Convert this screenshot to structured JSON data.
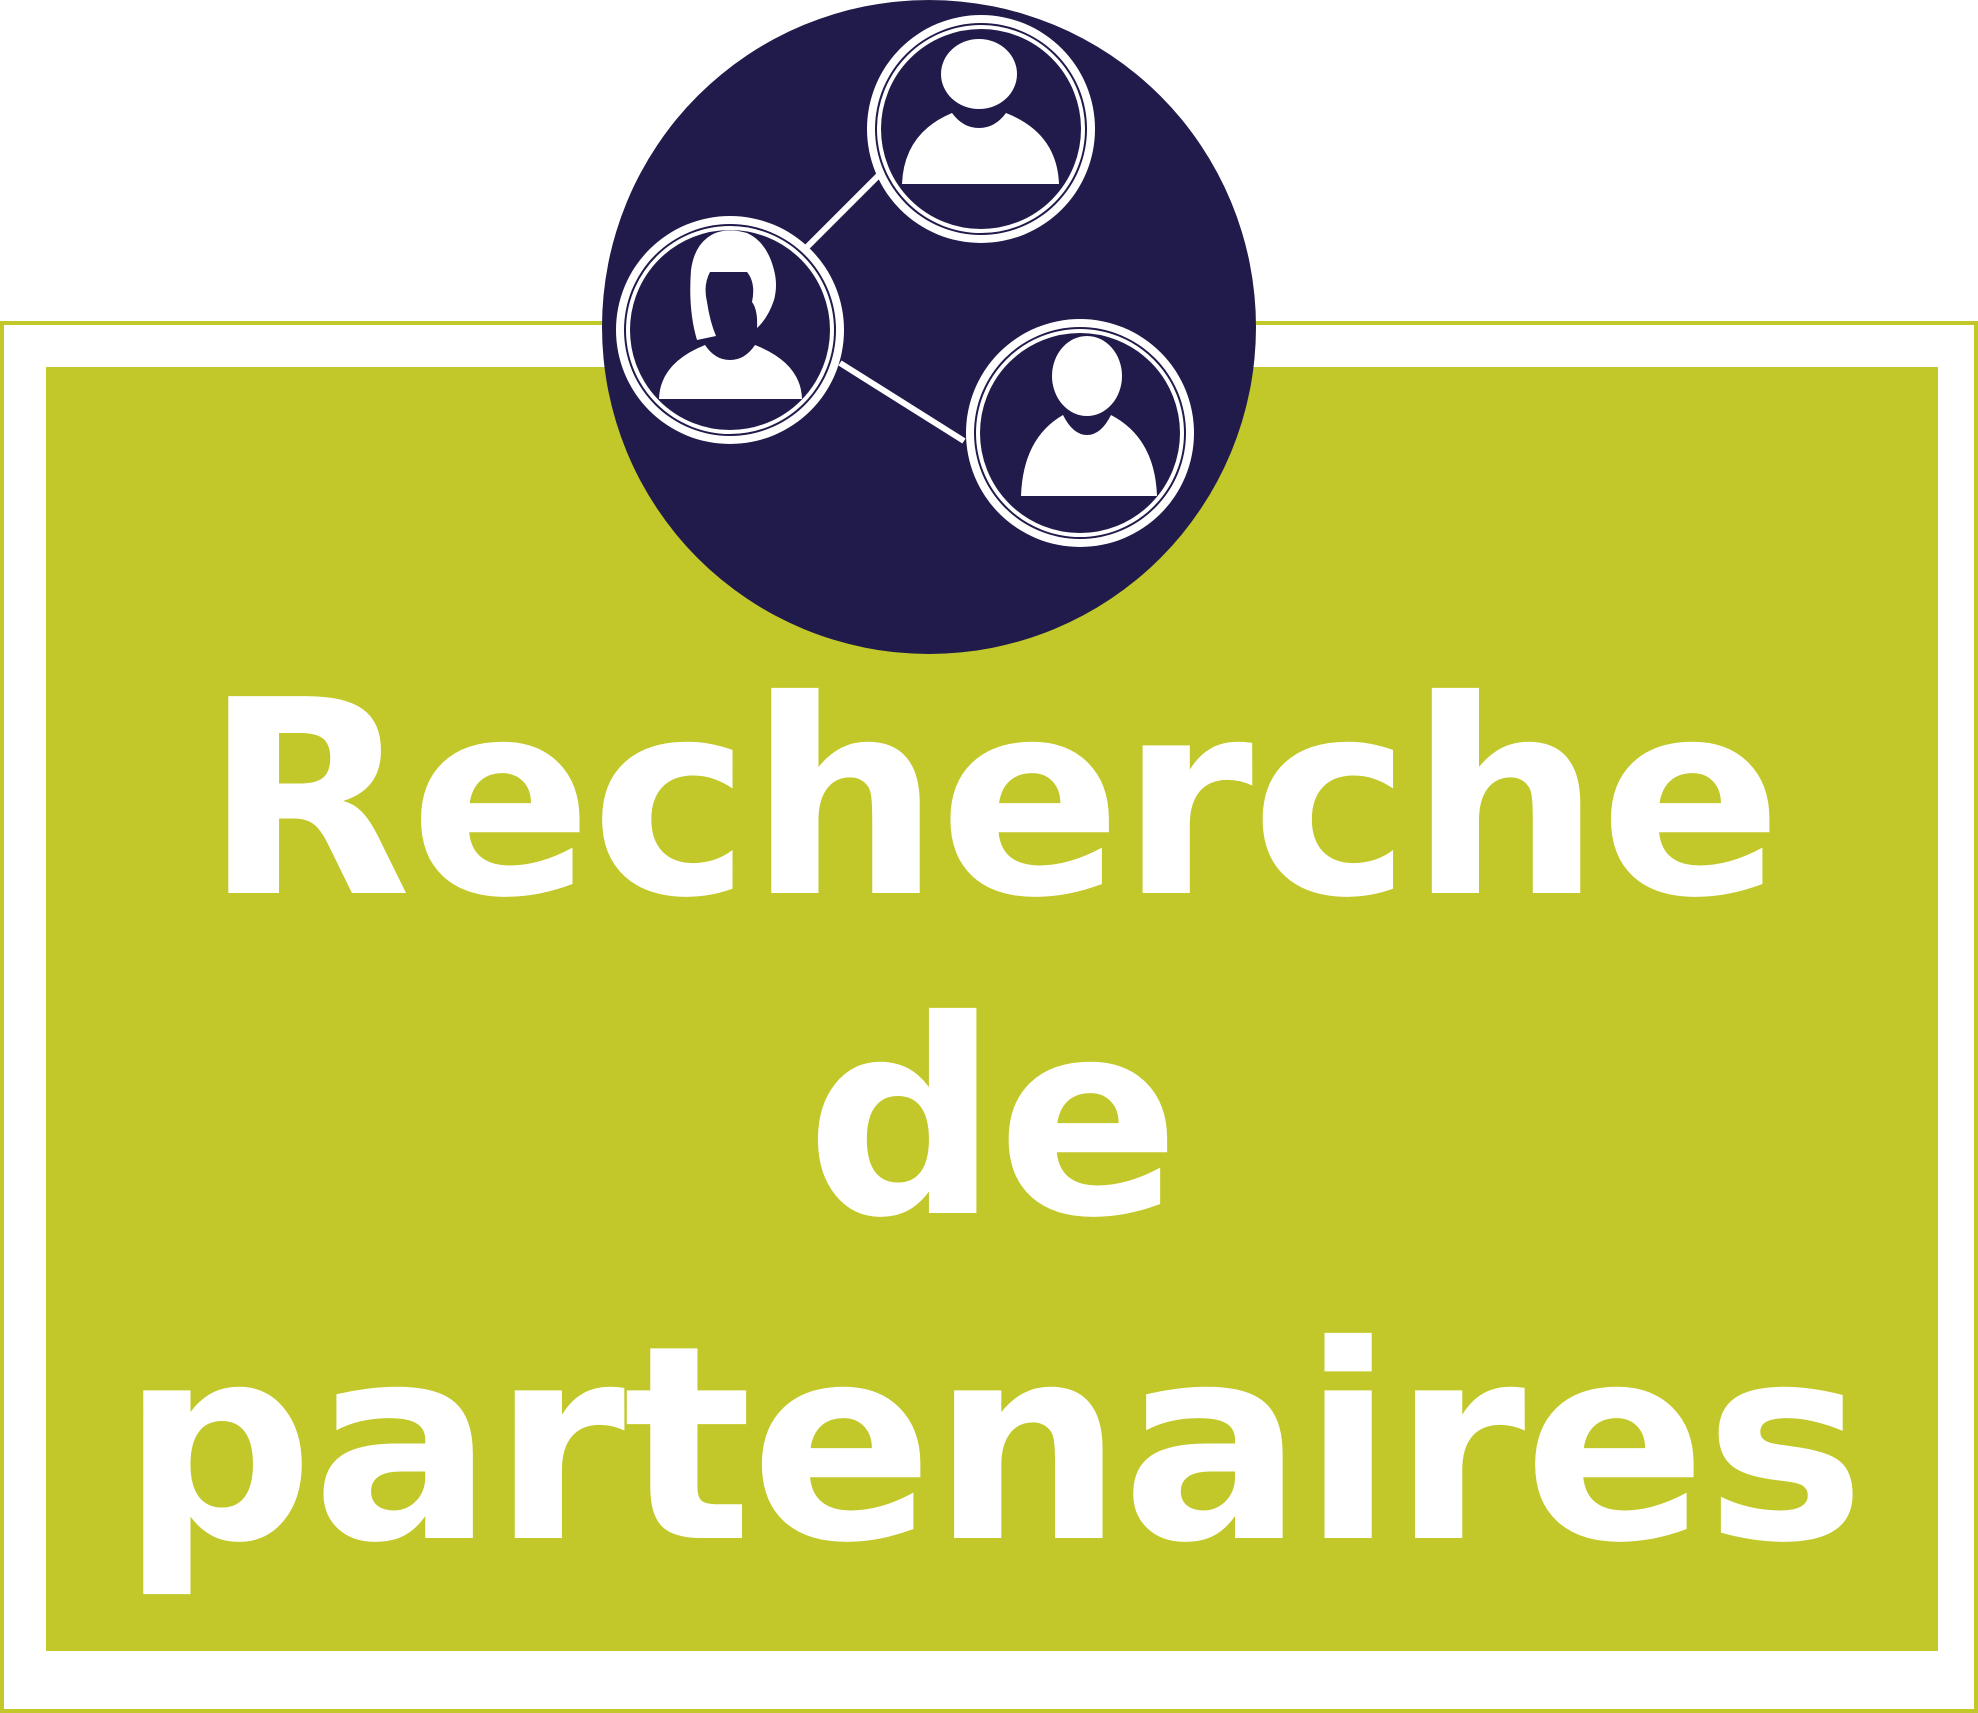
{
  "title": {
    "line1": "Recherche",
    "line2": "de",
    "line3": "partenaires"
  },
  "colors": {
    "panel": "#c2c829",
    "emblem_background": "#201b4a",
    "text": "#ffffff",
    "frame": "#ffffff"
  },
  "icons": {
    "emblem": "partner-network-icon",
    "person_top": "person-icon",
    "person_left": "woman-icon",
    "person_right": "person-icon"
  }
}
